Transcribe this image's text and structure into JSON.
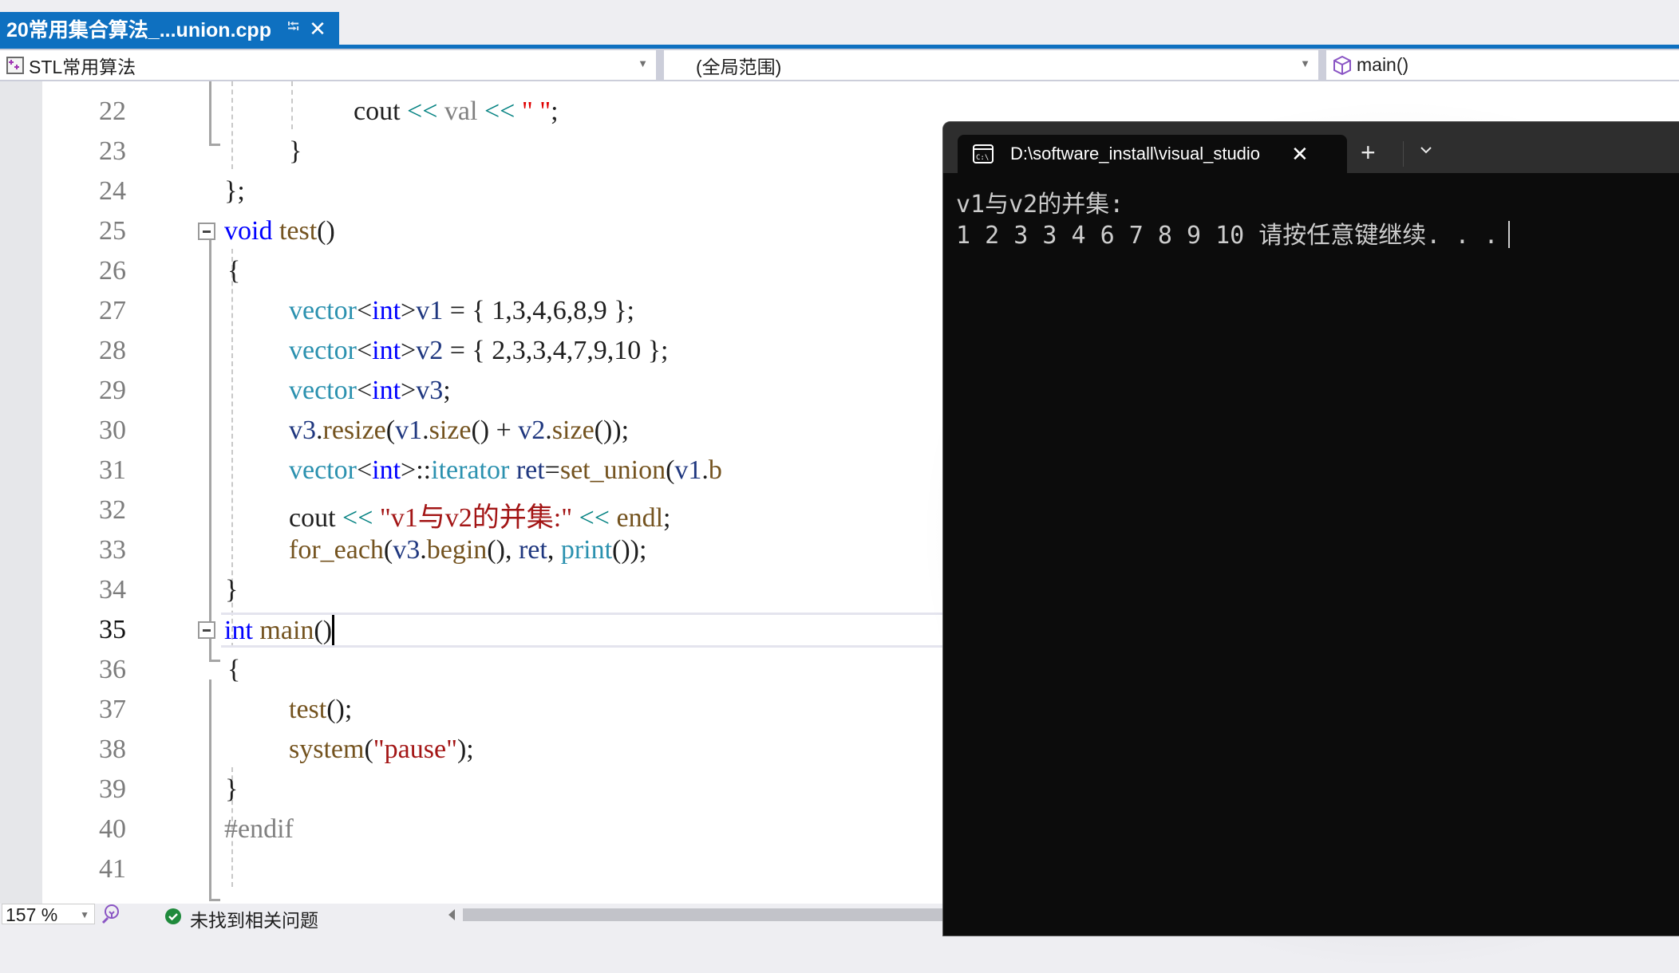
{
  "document_tab": {
    "title": "20常用集合算法_...union.cpp",
    "pin_icon": "pin-icon",
    "close_icon": "close-icon"
  },
  "navigation_bar": {
    "project": "STL常用算法",
    "scope": "(全局范围)",
    "member": "main()"
  },
  "editor": {
    "current_line": 35,
    "lines": [
      {
        "n": "22"
      },
      {
        "n": "23"
      },
      {
        "n": "24"
      },
      {
        "n": "25"
      },
      {
        "n": "26"
      },
      {
        "n": "27"
      },
      {
        "n": "28"
      },
      {
        "n": "29"
      },
      {
        "n": "30"
      },
      {
        "n": "31"
      },
      {
        "n": "32"
      },
      {
        "n": "33"
      },
      {
        "n": "34"
      },
      {
        "n": "35"
      },
      {
        "n": "36"
      },
      {
        "n": "37"
      },
      {
        "n": "38"
      },
      {
        "n": "39"
      },
      {
        "n": "40"
      },
      {
        "n": "41"
      }
    ],
    "code": {
      "l22": {
        "cout": "cout",
        "op1": " << ",
        "val": "val",
        "op2": " << ",
        "q1": "\"",
        "sp": " ",
        "q2": "\"",
        "end": ";"
      },
      "l23": {
        "text": "}"
      },
      "l24": {
        "text": "};"
      },
      "l25": {
        "kw": "void",
        "fn": " test",
        "rest": "()"
      },
      "l26": {
        "text": "{"
      },
      "l27": {
        "ty": "vector",
        "lt": "<",
        "kw": "int",
        "gt": ">",
        "var": "v1",
        "rest": " = { 1,3,4,6,8,9 };"
      },
      "l28": {
        "ty": "vector",
        "lt": "<",
        "kw": "int",
        "gt": ">",
        "var": "v2",
        "rest": " = { 2,3,3,4,7,9,10 };"
      },
      "l29": {
        "ty": "vector",
        "lt": "<",
        "kw": "int",
        "gt": ">",
        "var": "v3",
        "rest": ";"
      },
      "l30": {
        "v3": "v3",
        "dot": ".",
        "resize": "resize",
        "p1": "(",
        "v1": "v1",
        "dot2": ".",
        "size1": "size",
        "p2": "() + ",
        "v2": "v2",
        "dot3": ".",
        "size2": "size",
        "p3": "());"
      },
      "l31": {
        "ty": "vector",
        "lt": "<",
        "kw": "int",
        "gt": ">",
        "sep": "::",
        "it": "iterator",
        "sp": " ",
        "ret": "ret",
        "eq": "=",
        "fn": "set_union",
        "p": "(",
        "v1": "v1",
        "dot": ".",
        "b": "b"
      },
      "l32": {
        "cout": "cout",
        "op1": " << ",
        "str": "\"v1与v2的并集:\"",
        "op2": " << ",
        "endl": "endl",
        "end": ";"
      },
      "l33": {
        "fn": "for_each",
        "p1": "(",
        "v3": "v3",
        "dot": ".",
        "begin": "begin",
        "p2": "(), ",
        "ret": "ret",
        "c": ", ",
        "print": "print",
        "p3": "());"
      },
      "l34": {
        "text": "}"
      },
      "l35": {
        "kw": "int",
        "fn": " main",
        "rest": "()"
      },
      "l36": {
        "text": "{"
      },
      "l37": {
        "fn": "test",
        "rest": "();"
      },
      "l38": {
        "fn": "system",
        "p1": "(",
        "str": "\"pause\"",
        "p2": ");"
      },
      "l39": {
        "text": "}"
      },
      "l40": {
        "pp": "#endif"
      }
    }
  },
  "status_bar": {
    "zoom": "157 %",
    "issues": "未找到相关问题"
  },
  "terminal": {
    "tab_title": "D:\\software_install\\visual_studio",
    "icon": "cmd-icon",
    "new_tab_label": "+",
    "output": [
      "v1与v2的并集:",
      "1 2 3 3 4 6 7 8 9 10 请按任意键继续. . ."
    ]
  },
  "colors": {
    "accent": "#0e70c0",
    "keyword": "#0000ff",
    "type": "#2b91af",
    "function": "#74531f",
    "string": "#a31515",
    "terminal_bg": "#0c0c0c"
  }
}
